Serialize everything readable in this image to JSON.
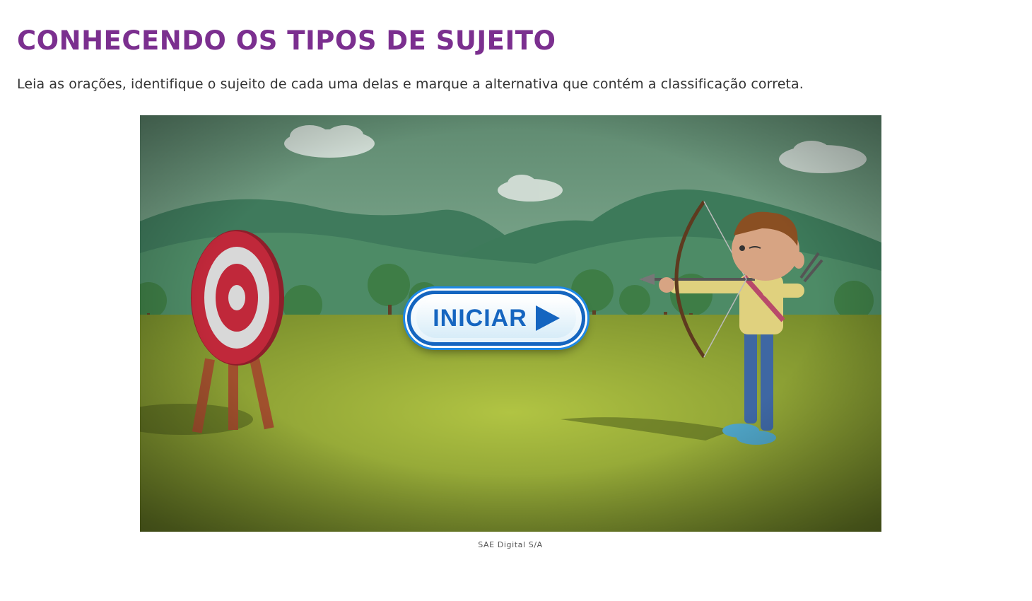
{
  "title": "CONHECENDO OS TIPOS DE SUJEITO",
  "instructions": "Leia as orações, identifique o sujeito de cada uma delas e marque a alternativa que contém a classificação correta.",
  "game": {
    "start_label": "INICIAR",
    "start_icon": "play-icon"
  },
  "credit": "SAE Digital S/A",
  "colors": {
    "title": "#7b2f8f",
    "button_blue": "#1565c0",
    "grass": "#9fb43a",
    "target_red": "#c0283a"
  }
}
